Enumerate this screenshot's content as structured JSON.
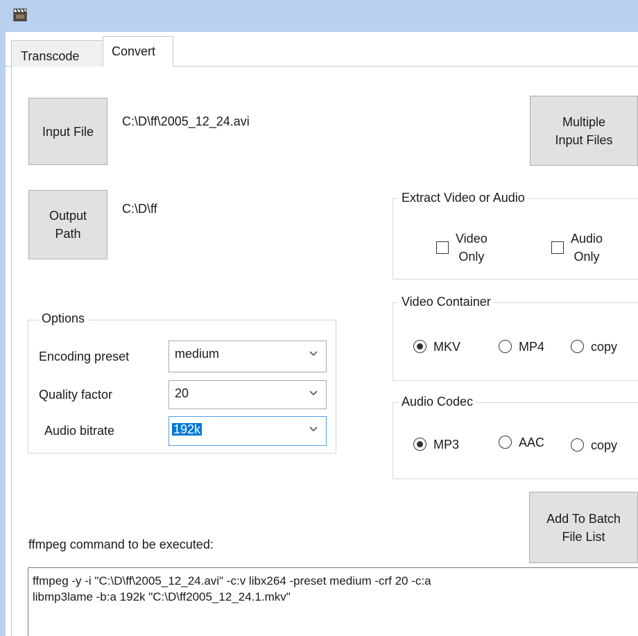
{
  "window": {
    "icon": "clapperboard-icon"
  },
  "tabs": [
    {
      "label": "Transcode",
      "active": false
    },
    {
      "label": "Convert",
      "active": true
    }
  ],
  "files": {
    "input_button": "Input File",
    "input_path": "C:\\D\\ff\\2005_12_24.avi",
    "output_button_line1": "Output",
    "output_button_line2": "Path",
    "output_path": "C:\\D\\ff",
    "multiple_button_line1": "Multiple",
    "multiple_button_line2": "Input Files"
  },
  "options": {
    "title": "Options",
    "encoding_preset_label": "Encoding preset",
    "encoding_preset_value": "medium",
    "quality_factor_label": "Quality factor",
    "quality_factor_value": "20",
    "audio_bitrate_label": "Audio bitrate",
    "audio_bitrate_value": "192k"
  },
  "extract": {
    "title": "Extract Video or Audio",
    "video_only_line1": "Video",
    "video_only_line2": "Only",
    "video_only_checked": false,
    "audio_only_line1": "Audio",
    "audio_only_line2": "Only",
    "audio_only_checked": false
  },
  "video_container": {
    "title": "Video Container",
    "options": [
      "MKV",
      "MP4",
      "copy"
    ],
    "selected": "MKV"
  },
  "audio_codec": {
    "title": "Audio Codec",
    "options": [
      "MP3",
      "AAC",
      "copy"
    ],
    "selected": "MP3"
  },
  "batch": {
    "button_line1": "Add To Batch",
    "button_line2": "File List"
  },
  "command": {
    "caption": "ffmpeg command to be executed:",
    "text": "ffmpeg -y -i \"C:\\D\\ff\\2005_12_24.avi\" -c:v libx264 -preset medium -crf 20 -c:a\nlibmp3lame -b:a 192k \"C:\\D\\ff2005_12_24.1.mkv\""
  }
}
